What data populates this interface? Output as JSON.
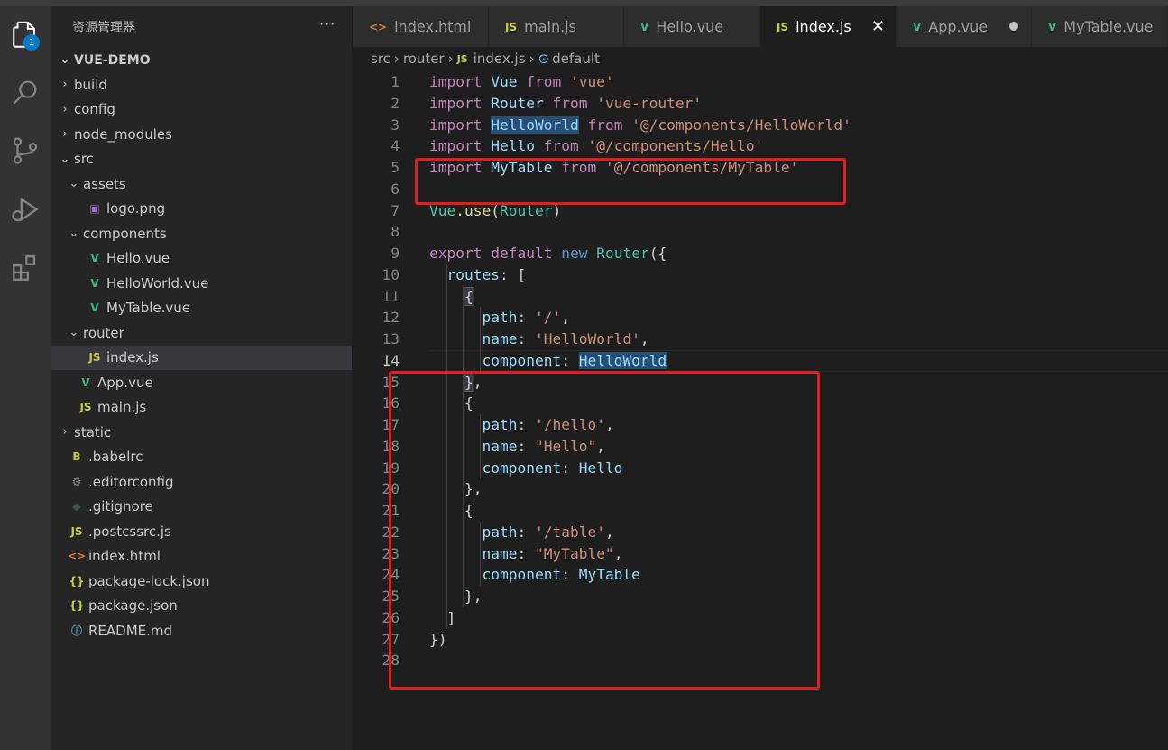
{
  "sidebar": {
    "title": "资源管理器",
    "more": "···",
    "project": "VUE-DEMO",
    "items": [
      {
        "label": "build",
        "chev": "›",
        "icon": "",
        "icon_color": ""
      },
      {
        "label": "config",
        "chev": "›",
        "icon": "",
        "icon_color": ""
      },
      {
        "label": "node_modules",
        "chev": "›",
        "icon": "",
        "icon_color": ""
      },
      {
        "label": "src",
        "chev": "⌄",
        "icon": "",
        "icon_color": ""
      },
      {
        "label": "assets",
        "chev": "⌄",
        "icon": "",
        "icon_color": ""
      },
      {
        "label": "logo.png",
        "chev": "",
        "icon": "▣",
        "icon_color": "#a074c4"
      },
      {
        "label": "components",
        "chev": "⌄",
        "icon": "",
        "icon_color": ""
      },
      {
        "label": "Hello.vue",
        "chev": "",
        "icon": "V",
        "icon_color": "#41b883"
      },
      {
        "label": "HelloWorld.vue",
        "chev": "",
        "icon": "V",
        "icon_color": "#41b883"
      },
      {
        "label": "MyTable.vue",
        "chev": "",
        "icon": "V",
        "icon_color": "#41b883"
      },
      {
        "label": "router",
        "chev": "⌄",
        "icon": "",
        "icon_color": ""
      },
      {
        "label": "index.js",
        "chev": "",
        "icon": "JS",
        "icon_color": "#cbcb41"
      },
      {
        "label": "App.vue",
        "chev": "",
        "icon": "V",
        "icon_color": "#41b883"
      },
      {
        "label": "main.js",
        "chev": "",
        "icon": "JS",
        "icon_color": "#cbcb41"
      },
      {
        "label": "static",
        "chev": "›",
        "icon": "",
        "icon_color": ""
      },
      {
        "label": ".babelrc",
        "chev": "",
        "icon": "B",
        "icon_color": "#cbcb41"
      },
      {
        "label": ".editorconfig",
        "chev": "",
        "icon": "⚙",
        "icon_color": "#8a8a8a"
      },
      {
        "label": ".gitignore",
        "chev": "",
        "icon": "◆",
        "icon_color": "#41535b"
      },
      {
        "label": ".postcssrc.js",
        "chev": "",
        "icon": "JS",
        "icon_color": "#cbcb41"
      },
      {
        "label": "index.html",
        "chev": "",
        "icon": "<>",
        "icon_color": "#e37933"
      },
      {
        "label": "package-lock.json",
        "chev": "",
        "icon": "{}",
        "icon_color": "#cbcb41"
      },
      {
        "label": "package.json",
        "chev": "",
        "icon": "{}",
        "icon_color": "#cbcb41"
      },
      {
        "label": "README.md",
        "chev": "",
        "icon": "ⓘ",
        "icon_color": "#519aba"
      }
    ]
  },
  "activity": {
    "badge": "1"
  },
  "tabs": [
    {
      "label": "index.html",
      "icon": "<>",
      "icon_color": "#e37933"
    },
    {
      "label": "main.js",
      "icon": "JS",
      "icon_color": "#cbcb41"
    },
    {
      "label": "Hello.vue",
      "icon": "V",
      "icon_color": "#41b883"
    },
    {
      "label": "index.js",
      "icon": "JS",
      "icon_color": "#cbcb41",
      "close": "✕"
    },
    {
      "label": "App.vue",
      "icon": "V",
      "icon_color": "#41b883"
    },
    {
      "label": "MyTable.vue",
      "icon": "V",
      "icon_color": "#41b883"
    }
  ],
  "breadcrumb": {
    "p1": "src",
    "p2": "router",
    "p3_icon": "JS",
    "p3": "index.js",
    "p4_icon": "⊙",
    "p4": "default",
    "sep": "›"
  },
  "code": {
    "line_numbers": [
      "1",
      "2",
      "3",
      "4",
      "5",
      "6",
      "7",
      "8",
      "9",
      "10",
      "11",
      "12",
      "13",
      "14",
      "15",
      "16",
      "17",
      "18",
      "19",
      "20",
      "21",
      "22",
      "23",
      "24",
      "25",
      "26",
      "27",
      "28"
    ],
    "tokens": {
      "import": "import",
      "from": "from",
      "export": "export",
      "default": "default",
      "new": "new",
      "Vue": "Vue",
      "Router": "Router",
      "HelloWorld": "HelloWorld",
      "Hello": "Hello",
      "MyTable": "MyTable",
      "s_vue": "'vue'",
      "s_router": "'vue-router'",
      "s_hw": "'@/components/HelloWorld'",
      "s_hello": "'@/components/Hello'",
      "s_mt": "'@/components/MyTable'",
      "use": "use",
      "routes": "routes",
      "path": "path",
      "name": "name",
      "component": "component",
      "p_root": "'/'",
      "n_hw": "'HelloWorld'",
      "p_hello": "'/hello'",
      "n_hello": "\"Hello\"",
      "p_table": "'/table'",
      "n_mt": "\"MyTable\""
    }
  }
}
